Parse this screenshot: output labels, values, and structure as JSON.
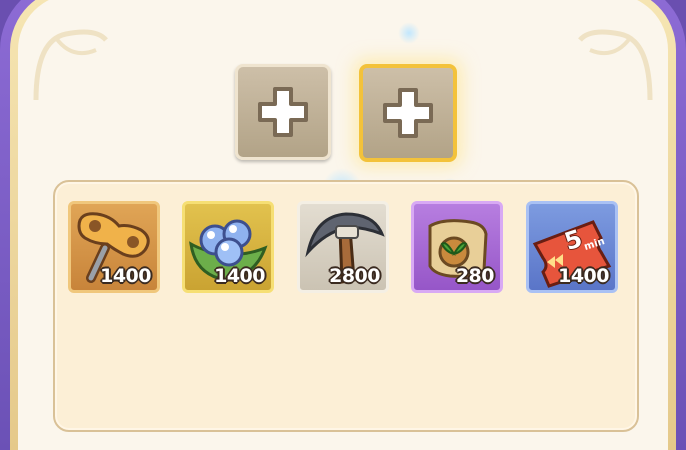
{
  "slots": [
    {
      "name": "empty-slot-1",
      "icon": "plus-icon",
      "selected": false
    },
    {
      "name": "empty-slot-2",
      "icon": "plus-icon",
      "selected": true
    }
  ],
  "items": [
    {
      "icon": "wind-up-key-icon",
      "count": "1400",
      "rarity_color": "#d8953e"
    },
    {
      "icon": "blue-orbs-icon",
      "count": "1400",
      "rarity_color": "#d9b73c"
    },
    {
      "icon": "pickaxe-icon",
      "count": "2800",
      "rarity_color": "#d8d1c3"
    },
    {
      "icon": "seed-scroll-icon",
      "count": "280",
      "rarity_color": "#a86ad6"
    },
    {
      "icon": "speedup-ticket-icon",
      "count": "1400",
      "rarity_color": "#6b88d6",
      "ticket_text": "5",
      "ticket_unit": "min"
    }
  ]
}
